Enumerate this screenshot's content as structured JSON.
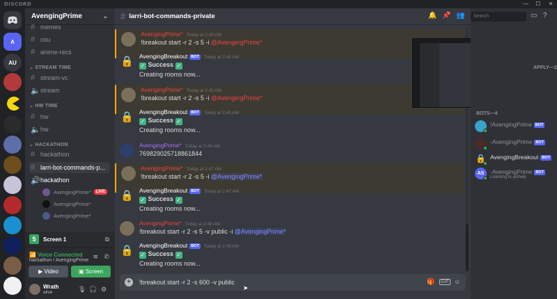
{
  "app": {
    "brand": "DISCORD"
  },
  "server": {
    "name": "AvengingPrime"
  },
  "channels": {
    "top_items": [
      {
        "label": "memes"
      },
      {
        "label": "osu"
      },
      {
        "label": "anime-recs"
      }
    ],
    "categories": {
      "stream_time": "STREAM TIME",
      "hw_time": "HW TIME",
      "hackathon": "HACKATHON"
    },
    "stream_items": [
      {
        "label": "stream-vc"
      },
      {
        "label": "stream"
      }
    ],
    "hw_items": [
      {
        "label": "hw"
      },
      {
        "label": "hw"
      }
    ],
    "hackathon_items": [
      {
        "label": "hackathon"
      },
      {
        "label": "larri-bot-commands-p..."
      }
    ],
    "voice_channel": "hackathon",
    "voice_users": [
      {
        "name": "AvengingPrime*",
        "badge": "LIVE"
      },
      {
        "name": "AvengingPrime*"
      },
      {
        "name": "AvengingPrime*"
      }
    ]
  },
  "guild_icons": {
    "home_initial": "A",
    "au": "AU"
  },
  "screen_bar": {
    "label": "Screen 1"
  },
  "voice": {
    "status": "Voice Connected",
    "sub": "hackathon / AvengingPrime",
    "video_label": "Video",
    "screen_label": "Screen"
  },
  "user": {
    "name": "Wrath",
    "status": "alive"
  },
  "chat": {
    "title": "larri-bot-commands-private",
    "composer_text": "!breakout start -r 2 -s 600 -v public",
    "messages": [
      {
        "author": "AvengingPrime*",
        "time": "Today at 2:45 AM",
        "text_pre": "!breakout start -r 2 -s 5 -i ",
        "mention": "@AvengingPrime*",
        "highlight": true,
        "red": true
      },
      {
        "author": "AvengingBreakout",
        "bot": "BOT",
        "time": "Today at 2:45 AM",
        "text": "Success",
        "text2": "Creating rooms now..."
      },
      {
        "author": "AvengingPrime*",
        "time": "Today at 2:45 AM",
        "text_pre": "!breakout start -r 2 -s 5 -i ",
        "mention": "@AvengingPrime*",
        "highlight": true,
        "red": true
      },
      {
        "author": "AvengingBreakout",
        "bot": "BOT",
        "time": "Today at 2:45 AM",
        "text": "Success",
        "text2": "Creating rooms now..."
      },
      {
        "author": "AvengingPrime*",
        "time": "Today at 2:45 AM",
        "text": "769829025718861844"
      },
      {
        "author": "AvengingPrime*",
        "time": "Today at 2:47 AM",
        "text_pre": "!breakout start -r 2 -s 5 -i ",
        "mention": "@AvengingPrime*",
        "highlight": true,
        "red": true
      },
      {
        "author": "AvengingBreakout",
        "bot": "BOT",
        "time": "Today at 2:47 AM",
        "text": "Success",
        "text2": "Creating rooms now..."
      },
      {
        "author": "AvengingPrime*",
        "time": "Today at 2:48 AM",
        "text_pre": "!breakout start -r 2 -s 5 -v public -i ",
        "mention": "@AvengingPrime*",
        "red": true
      },
      {
        "author": "AvengingBreakout",
        "bot": "BOT",
        "time": "Today at 2:48 AM",
        "text": "Success",
        "text2": "Creating rooms now..."
      }
    ]
  },
  "members": {
    "search_placeholder": "Search",
    "bots_header": "BOTS—4",
    "partial_header": "APPLY—2",
    "bots": [
      {
        "name": "!AvengingPrime",
        "badge": "BOT"
      },
      {
        "name": "-AvengingPrime",
        "badge": "BOT"
      },
      {
        "name": "AvengingBreakout",
        "badge": "BOT"
      },
      {
        "name": "-AvengingPrime",
        "badge": "BOT",
        "sub": "Listening to as!help"
      }
    ]
  },
  "colors": {
    "accent": "#5865f2",
    "green": "#3ba55d",
    "red": "#ed4245",
    "highlight": "#faa61a"
  }
}
